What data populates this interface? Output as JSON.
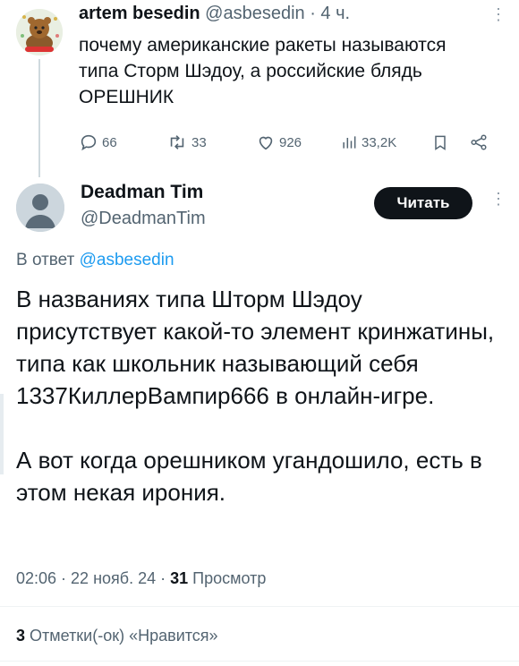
{
  "parent_tweet": {
    "author_name": "artem besedin",
    "author_handle": "@asbesedin",
    "time": "· 4 ч.",
    "text": "почему американские ракеты называются типа Сторм Шэдоу, а российские блядь ОРЕШНИК",
    "replies": "66",
    "retweets": "33",
    "likes": "926",
    "views": "33,2K"
  },
  "reply_tweet": {
    "author_name": "Deadman Tim",
    "author_handle": "@DeadmanTim",
    "follow_label": "Читать",
    "reply_prefix": "В ответ",
    "reply_to": "@asbesedin",
    "text": "В названиях типа Шторм Шэдоу присутствует какой-то элемент кринжатины, типа как школьник называющий себя 1337КиллерВампир666 в онлайн-игре.\n\nА вот когда орешником угандошило, есть в этом некая ирония.",
    "time": "02:06 · 22 нояб. 24 ·",
    "views_count": "31",
    "views_label": "Просмотр",
    "likes_count": "3",
    "likes_label": "Отметки(-ок) «Нравится»"
  },
  "colors": {
    "accent": "#1d9bf0",
    "muted": "#536471",
    "button": "#0f1419"
  },
  "icons": [
    "more-icon",
    "reply-icon",
    "retweet-icon",
    "like-icon",
    "views-icon",
    "bookmark-icon",
    "share-icon"
  ]
}
